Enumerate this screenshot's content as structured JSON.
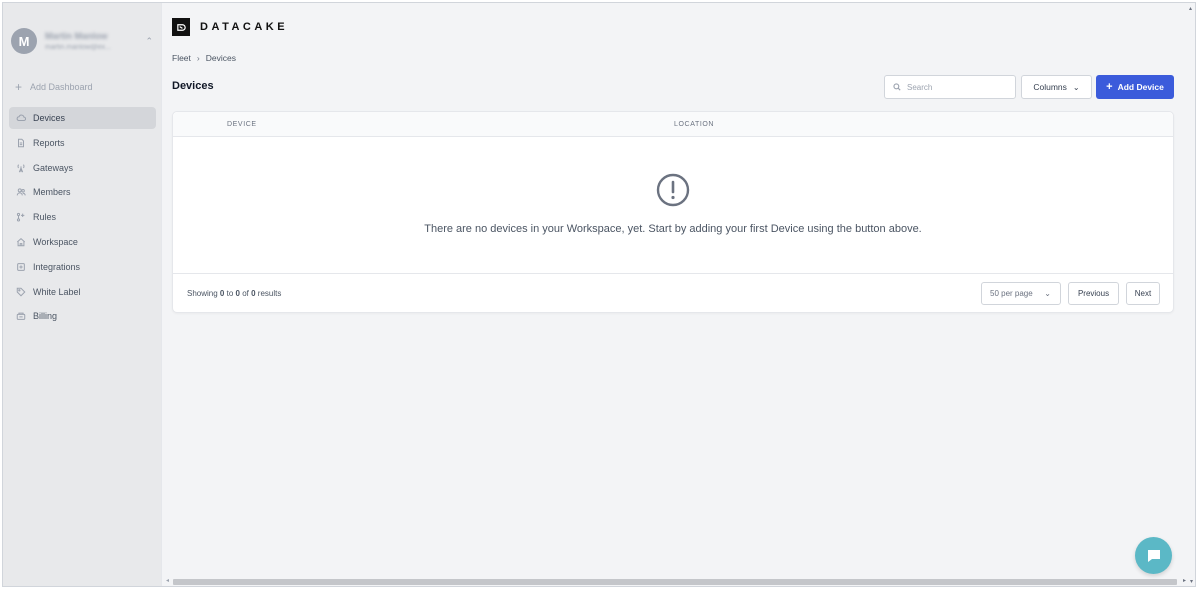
{
  "user": {
    "initial": "M",
    "name": "Martin Manlow",
    "email": "martin.manlow@ex..."
  },
  "sidebar": {
    "add_dashboard": "Add Dashboard",
    "items": [
      {
        "label": "Devices",
        "icon": "cloud-icon",
        "active": true
      },
      {
        "label": "Reports",
        "icon": "document-icon",
        "active": false
      },
      {
        "label": "Gateways",
        "icon": "antenna-icon",
        "active": false
      },
      {
        "label": "Members",
        "icon": "users-icon",
        "active": false
      },
      {
        "label": "Rules",
        "icon": "rules-icon",
        "active": false
      },
      {
        "label": "Workspace",
        "icon": "home-icon",
        "active": false
      },
      {
        "label": "Integrations",
        "icon": "puzzle-icon",
        "active": false
      },
      {
        "label": "White Label",
        "icon": "tag-icon",
        "active": false
      },
      {
        "label": "Billing",
        "icon": "billing-icon",
        "active": false
      }
    ]
  },
  "brand": {
    "name": "DATACAKE"
  },
  "breadcrumb": {
    "root": "Fleet",
    "current": "Devices"
  },
  "page": {
    "title": "Devices"
  },
  "toolbar": {
    "search_placeholder": "Search",
    "columns_label": "Columns",
    "add_device_label": "Add Device"
  },
  "table": {
    "columns": [
      "DEVICE",
      "LOCATION"
    ],
    "empty_message": "There are no devices in your Workspace, yet. Start by adding your first Device using the button above."
  },
  "pagination": {
    "showing_prefix": "Showing",
    "from": "0",
    "to_word": "to",
    "to": "0",
    "of_word": "of",
    "total": "0",
    "suffix": "results",
    "per_page": "50 per page",
    "previous_label": "Previous",
    "next_label": "Next"
  },
  "colors": {
    "accent": "#3b5bdb",
    "chat": "#5bb8c6",
    "sidebar_bg": "#e8e9eb"
  }
}
